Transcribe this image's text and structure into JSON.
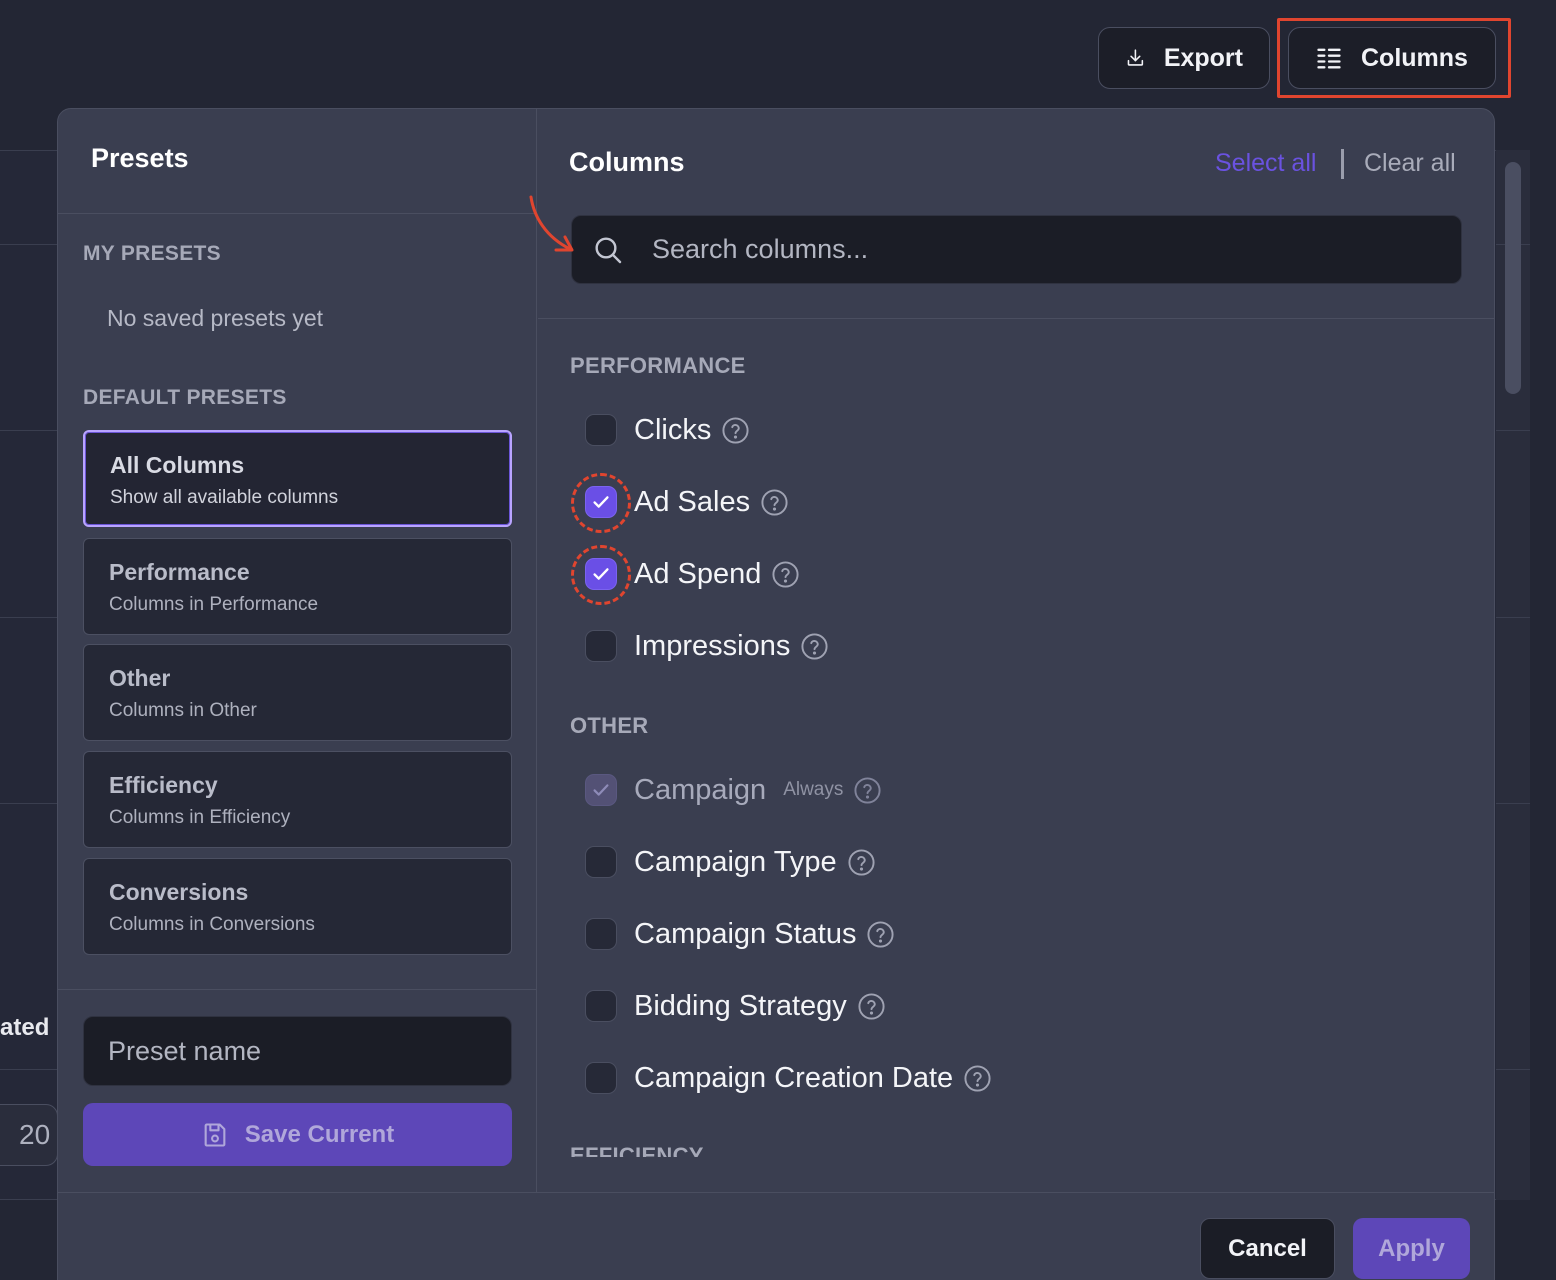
{
  "toolbar": {
    "export_label": "Export",
    "columns_label": "Columns"
  },
  "background": {
    "cut_header_text": "ated",
    "pagination_value": "20"
  },
  "presets": {
    "title": "Presets",
    "my_presets_label": "MY PRESETS",
    "no_presets_text": "No saved presets yet",
    "default_presets_label": "DEFAULT PRESETS",
    "items": [
      {
        "name": "All Columns",
        "description": "Show all available columns",
        "active": true
      },
      {
        "name": "Performance",
        "description": "Columns in Performance",
        "active": false
      },
      {
        "name": "Other",
        "description": "Columns in Other",
        "active": false
      },
      {
        "name": "Efficiency",
        "description": "Columns in Efficiency",
        "active": false
      },
      {
        "name": "Conversions",
        "description": "Columns in Conversions",
        "active": false
      }
    ],
    "preset_name_placeholder": "Preset name",
    "save_current_label": "Save Current"
  },
  "columns": {
    "title": "Columns",
    "select_all_label": "Select all",
    "clear_all_label": "Clear all",
    "search_placeholder": "Search columns...",
    "groups": [
      {
        "label": "PERFORMANCE",
        "items": [
          {
            "label": "Clicks",
            "checked": false
          },
          {
            "label": "Ad Sales",
            "checked": true
          },
          {
            "label": "Ad Spend",
            "checked": true
          },
          {
            "label": "Impressions",
            "checked": false
          }
        ]
      },
      {
        "label": "OTHER",
        "items": [
          {
            "label": "Campaign",
            "checked": true,
            "always": true,
            "tag": "Always"
          },
          {
            "label": "Campaign Type",
            "checked": false
          },
          {
            "label": "Campaign Status",
            "checked": false
          },
          {
            "label": "Bidding Strategy",
            "checked": false
          },
          {
            "label": "Campaign Creation Date",
            "checked": false
          }
        ]
      },
      {
        "label": "EFFICIENCY",
        "items": []
      }
    ]
  },
  "footer": {
    "cancel_label": "Cancel",
    "apply_label": "Apply"
  },
  "colors": {
    "accent": "#6a4fe6",
    "annotation": "#e0452f",
    "modal_bg": "#3a3e50"
  }
}
